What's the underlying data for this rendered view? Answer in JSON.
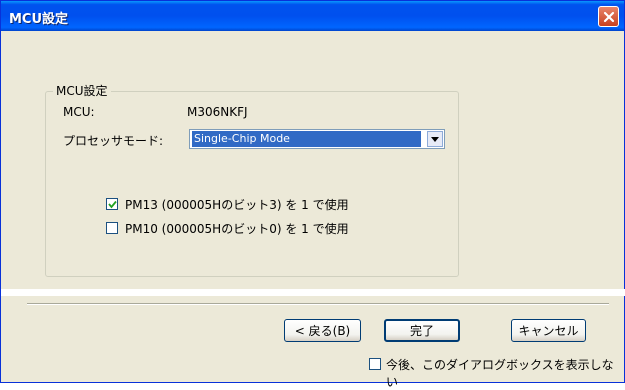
{
  "window": {
    "title": "MCU設定"
  },
  "group": {
    "legend": "MCU設定",
    "mcu_label": "MCU:",
    "mcu_value": "M306NKFJ",
    "mode_label": "プロセッサモード:",
    "mode_selected": "Single-Chip Mode"
  },
  "options": [
    {
      "label": "PM13 (000005Hのビット3) を 1 で使用",
      "checked": true
    },
    {
      "label": "PM10 (000005Hのビット0) を 1 で使用",
      "checked": false
    }
  ],
  "buttons": {
    "back": "< 戻る(B)",
    "finish": "完了",
    "cancel": "キャンセル"
  },
  "footer": {
    "dont_show_label": "今後、このダイアログボックスを表示しない",
    "checked": false
  },
  "colors": {
    "titlebar": "#0054e3",
    "selection": "#316ac5",
    "dialog_bg": "#ece9d8"
  }
}
